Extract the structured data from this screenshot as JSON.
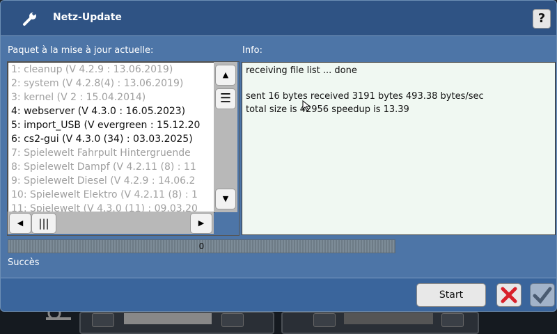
{
  "dialog": {
    "title": "Netz-Update",
    "help_label": "?"
  },
  "packages": {
    "label": "Paquet à la mise à jour actuelle:",
    "items": [
      {
        "text": "1: cleanup (V 4.2.9 : 13.06.2019)",
        "active": false
      },
      {
        "text": "2: system (V 4.2.8(4) : 13.06.2019)",
        "active": false
      },
      {
        "text": "3: kernel (V 2 : 15.04.2014)",
        "active": false
      },
      {
        "text": "4: webserver (V 4.3.0 : 16.05.2023)",
        "active": true
      },
      {
        "text": "5: import_USB (V evergreen : 15.12.20",
        "active": true
      },
      {
        "text": "6: cs2-gui (V 4.3.0 (34) : 03.03.2025)",
        "active": true
      },
      {
        "text": "7: Spielewelt Fahrpult Hintergruende",
        "active": false
      },
      {
        "text": "8: Spielewelt Dampf (V 4.2.11 (8) : 11",
        "active": false
      },
      {
        "text": "9: Spielewelt Diesel (V 4.2.9 : 14.06.2",
        "active": false
      },
      {
        "text": "10: Spielewelt Elektro (V 4.2.11 (8) : 1",
        "active": false
      },
      {
        "text": "11: Spielewelt (V 4.3.0 (11) : 09.03.20",
        "active": false
      }
    ]
  },
  "info": {
    "label": "Info:",
    "lines": [
      "receiving file list ... done",
      "",
      "sent 16 bytes  received 3191 bytes  493.38 bytes/sec",
      "total size is 42956  speedup is 13.39"
    ]
  },
  "progress": {
    "value_text": "0",
    "fraction": 0
  },
  "status": {
    "text": "Succès"
  },
  "footer": {
    "start_label": "Start"
  },
  "colors": {
    "dialog_bg": "#4d75a7",
    "titlebar_bg": "#2f5384",
    "cancel_red": "#d8212b"
  },
  "icons": {
    "title": "wrench-icon",
    "cancel": "close-icon",
    "ok": "checkmark-icon"
  }
}
